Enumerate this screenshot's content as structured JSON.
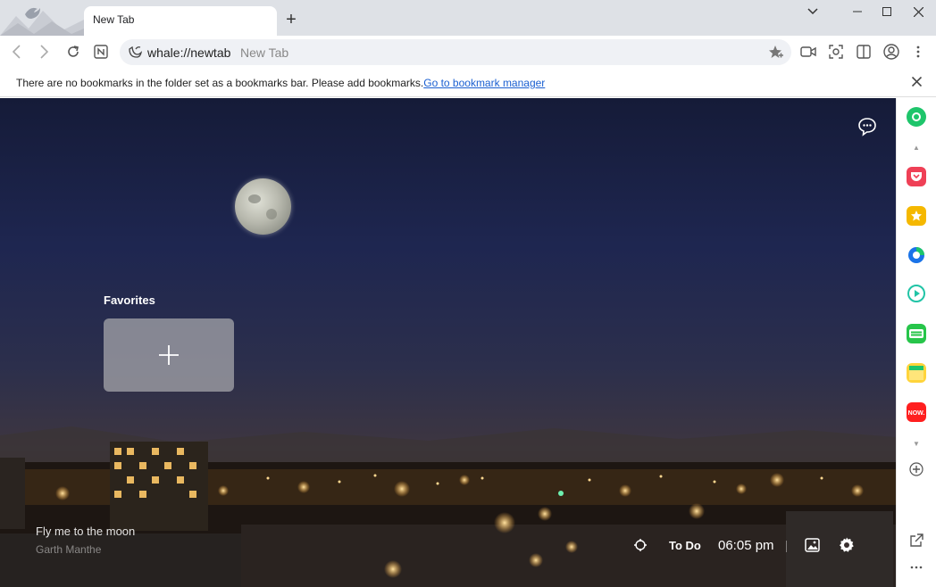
{
  "tab": {
    "title": "New Tab"
  },
  "omnibox": {
    "url": "whale://newtab",
    "page_title": "New Tab"
  },
  "bookmark_bar": {
    "message": "There are no bookmarks in the folder set as a bookmarks bar. Please add bookmarks.",
    "link": "Go to bookmark manager"
  },
  "newtab": {
    "favorites_label": "Favorites",
    "photo_title": "Fly me to the moon",
    "photo_author": "Garth Manthe",
    "todo_label": "To Do",
    "clock": "06:05 pm"
  },
  "sidebar": {
    "items": [
      {
        "name": "naver-green",
        "color": "#1ec56b"
      },
      {
        "name": "pocket",
        "color": "#ef4056"
      },
      {
        "name": "bookmark-star",
        "color": "#f5b800"
      },
      {
        "name": "papago-translate",
        "color": "#1a73e8"
      },
      {
        "name": "video-play",
        "color": "#21c4a6"
      },
      {
        "name": "webtoon",
        "color": "#27c54a"
      },
      {
        "name": "memo",
        "color": "#ffd43b"
      },
      {
        "name": "now",
        "color": "#ff1f1f"
      }
    ]
  },
  "colors": {
    "accent": "#1a5fd1"
  }
}
